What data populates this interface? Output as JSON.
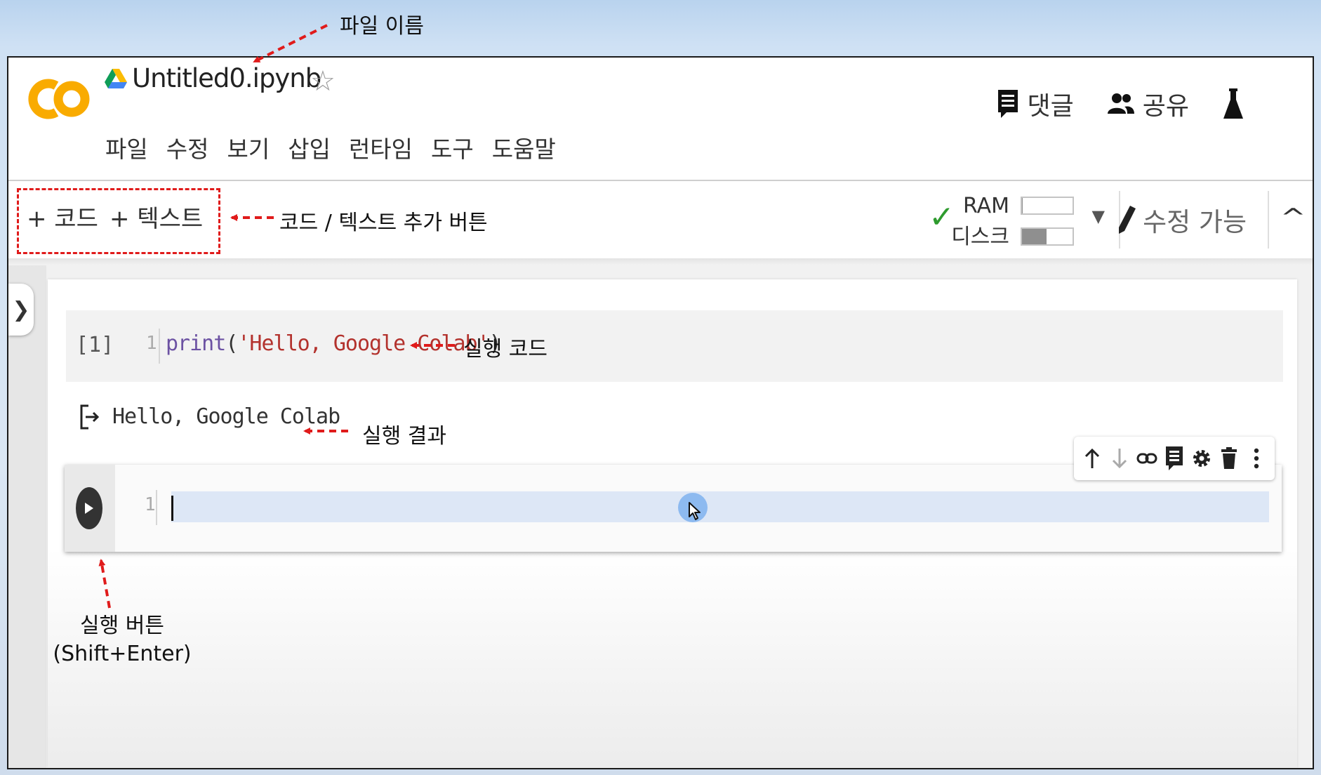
{
  "colors": {
    "annotation_red": "#e01b1b",
    "colab_orange": "#f9ab00",
    "check_green": "#2e9b2e",
    "code_keyword": "#6c52a3",
    "code_string": "#b3322d"
  },
  "header": {
    "logo_icon": "colab-logo-icon",
    "drive_icon": "google-drive-icon",
    "file_name": "Untitled0.ipynb",
    "star_icon": "star-icon",
    "menu": [
      "파일",
      "수정",
      "보기",
      "삽입",
      "런타임",
      "도구",
      "도움말"
    ],
    "comment_label": "댓글",
    "share_label": "공유",
    "labs_icon": "flask-icon"
  },
  "toolbar": {
    "add_code_label": "+ 코드",
    "add_text_label": "+ 텍스트",
    "ram_label": "RAM",
    "disk_label": "디스크",
    "ram_usage": 0.02,
    "disk_usage": 0.48,
    "edit_mode_label": "수정 가능",
    "collapse_glyph": "^"
  },
  "cells": {
    "cell1": {
      "exec_count": "[1]",
      "line_number": "1",
      "code_fn": "print",
      "code_open": "(",
      "code_string": "'Hello, Google Colab'",
      "code_close": ")"
    },
    "output_text": "Hello, Google Colab",
    "cell2": {
      "line_number": "1"
    },
    "cell_toolbar_icons": [
      "arrow-up-icon",
      "arrow-down-icon",
      "link-icon",
      "comment-icon",
      "gear-icon",
      "trash-icon",
      "more-vert-icon"
    ]
  },
  "annotations": {
    "file_name": "파일 이름",
    "add_buttons": "코드 / 텍스트 추가 버튼",
    "run_code": "실행 코드",
    "run_result": "실행 결과",
    "run_button": "실행 버튼",
    "run_button_shortcut": "(Shift+Enter)"
  }
}
